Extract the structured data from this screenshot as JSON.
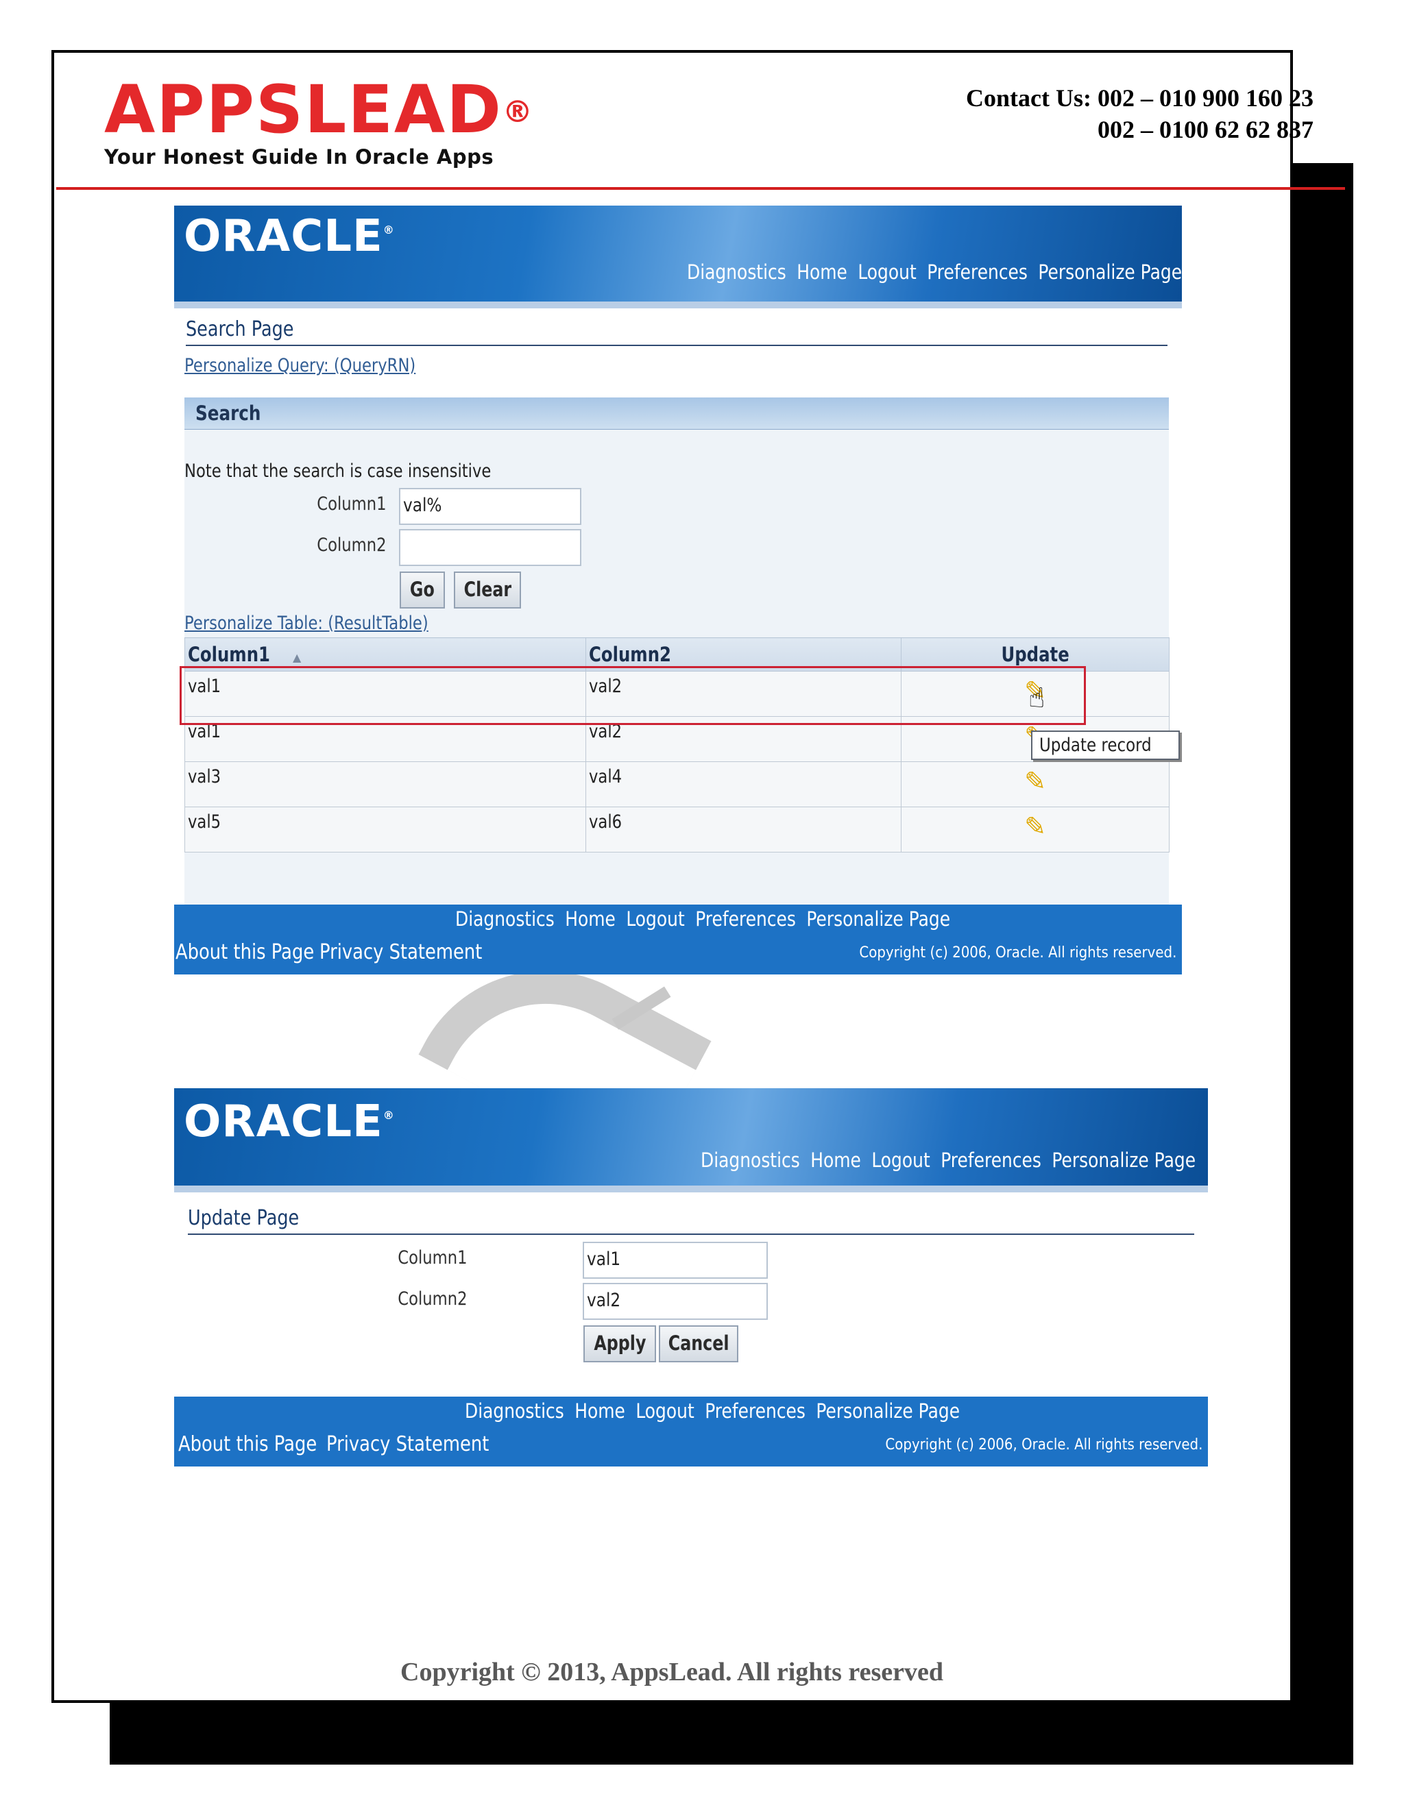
{
  "document": {
    "logo_title": "APPSLEAD",
    "logo_registered": "®",
    "logo_tagline": "Your Honest Guide In Oracle Apps",
    "contact_line1": "Contact Us: 002 – 010 900 160 23",
    "contact_line2": "002 – 0100 62 62 837",
    "copyright": "Copyright © 2013, AppsLead. All rights reserved"
  },
  "search_screenshot": {
    "banner": {
      "logo": "ORACLE",
      "links": [
        "Diagnostics",
        "Home",
        "Logout",
        "Preferences",
        "Personalize Page"
      ]
    },
    "page_title": "Search Page",
    "personalize_query_link": "Personalize Query: (QueryRN)",
    "search_header": "Search",
    "note": "Note that the search is case insensitive",
    "fields": [
      {
        "label": "Column1",
        "value": "val%"
      },
      {
        "label": "Column2",
        "value": ""
      }
    ],
    "go_button": "Go",
    "clear_button": "Clear",
    "personalize_table_link": "Personalize Table: (ResultTable)",
    "table": {
      "headers": [
        "Column1",
        "Column2",
        "Update"
      ],
      "sort_indicator": "▲",
      "rows": [
        [
          "val1",
          "val2"
        ],
        [
          "val1",
          "val2"
        ],
        [
          "val3",
          "val4"
        ],
        [
          "val5",
          "val6"
        ]
      ],
      "update_icon": "pencil-icon"
    },
    "tooltip": "Update record",
    "footer": {
      "links": [
        "Diagnostics",
        "Home",
        "Logout",
        "Preferences",
        "Personalize Page"
      ],
      "about": "About this Page",
      "privacy": "Privacy Statement",
      "copyright": "Copyright (c) 2006, Oracle. All rights reserved."
    }
  },
  "update_screenshot": {
    "banner": {
      "logo": "ORACLE",
      "links": [
        "Diagnostics",
        "Home",
        "Logout",
        "Preferences",
        "Personalize Page"
      ]
    },
    "page_title": "Update Page",
    "fields": [
      {
        "label": "Column1",
        "value": "val1"
      },
      {
        "label": "Column2",
        "value": "val2"
      }
    ],
    "apply_button": "Apply",
    "cancel_button": "Cancel",
    "footer": {
      "links": [
        "Diagnostics",
        "Home",
        "Logout",
        "Preferences",
        "Personalize Page"
      ],
      "about": "About this Page",
      "privacy": "Privacy Statement",
      "copyright": "Copyright (c) 2006, Oracle. All rights reserved."
    }
  },
  "colors": {
    "brand_red": "#e4292b",
    "oracle_blue": "#1d72c5",
    "highlight_red": "#cc2233"
  }
}
